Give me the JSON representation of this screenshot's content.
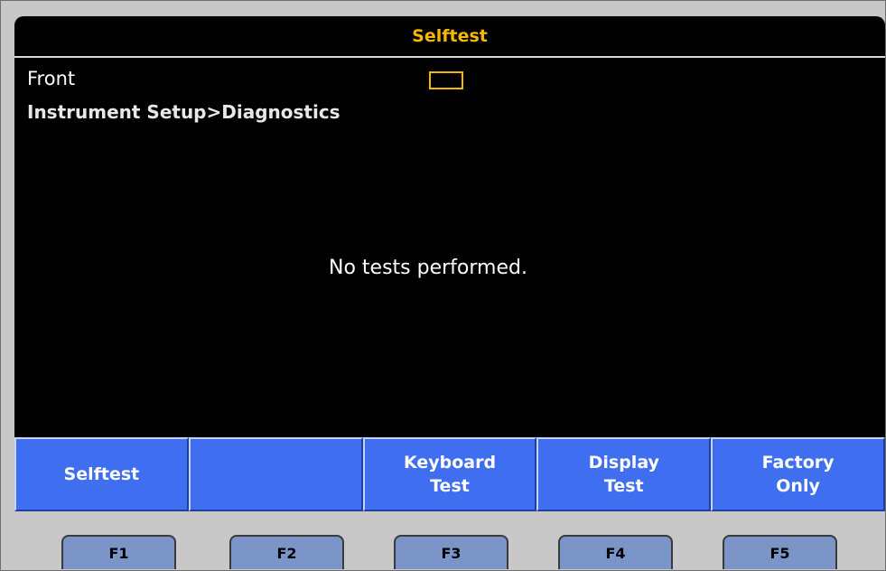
{
  "title": "Selftest",
  "front_label": "Front",
  "breadcrumb": "Instrument Setup>Diagnostics",
  "message": "No tests performed.",
  "softkeys": [
    {
      "label": "Selftest"
    },
    {
      "label": ""
    },
    {
      "label": "Keyboard\nTest"
    },
    {
      "label": "Display\nTest"
    },
    {
      "label": "Factory\nOnly"
    }
  ],
  "function_keys": [
    {
      "label": "F1"
    },
    {
      "label": "F2"
    },
    {
      "label": "F3"
    },
    {
      "label": "F4"
    },
    {
      "label": "F5"
    }
  ],
  "colors": {
    "screen_background": "#000000",
    "title_accent": "#f5b800",
    "softkey_blue": "#3f6ff0",
    "fkey_blue": "#7b95c9",
    "bezel_gray": "#c8c8c8"
  }
}
